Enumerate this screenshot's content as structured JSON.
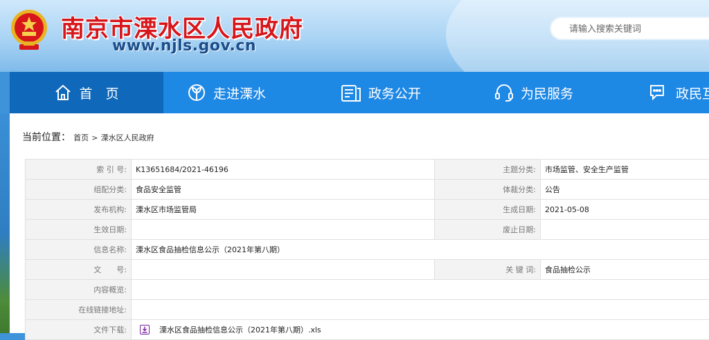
{
  "header": {
    "site_title": "南京市溧水区人民政府",
    "site_url": "www.njls.gov.cn",
    "search_placeholder": "请输入搜索关键词"
  },
  "nav": {
    "items": [
      {
        "label": "首　页",
        "icon": "home-icon",
        "active": true
      },
      {
        "label": "走进溧水",
        "icon": "leaf-icon",
        "active": false
      },
      {
        "label": "政务公开",
        "icon": "document-icon",
        "active": false
      },
      {
        "label": "为民服务",
        "icon": "headset-icon",
        "active": false
      },
      {
        "label": "政民互",
        "icon": "chat-icon",
        "active": false
      }
    ]
  },
  "breadcrumb": {
    "label": "当前位置：",
    "home": "首页",
    "sep": ">",
    "current": "溧水区人民政府"
  },
  "meta": {
    "index_no_label": "索 引 号:",
    "index_no": "K13651684/2021-46196",
    "topic_label": "主题分类:",
    "topic": "市场监管、安全生产监管",
    "org_cat_label": "组配分类:",
    "org_cat": "食品安全监管",
    "genre_label": "体裁分类:",
    "genre": "公告",
    "publisher_label": "发布机构:",
    "publisher": "溧水区市场监管局",
    "created_label": "生成日期:",
    "created": "2021-05-08",
    "effective_label": "生效日期:",
    "effective": "",
    "abolish_label": "废止日期:",
    "abolish": "",
    "info_name_label": "信息名称:",
    "info_name": "溧水区食品抽检信息公示（2021年第八期）",
    "doc_no_label": "文　　号:",
    "doc_no": "",
    "keywords_label": "关 键 词:",
    "keywords": "食品抽检公示",
    "summary_label": "内容概览:",
    "summary": "",
    "link_label": "在线链接地址:",
    "link": "",
    "download_label": "文件下载:",
    "download_file": "溧水区食品抽检信息公示（2021年第八期）.xls"
  },
  "colors": {
    "title_red": "#d7161b",
    "nav_blue": "#1e88e5",
    "nav_active": "#0f68b9",
    "download_icon": "#7b1fa2"
  }
}
